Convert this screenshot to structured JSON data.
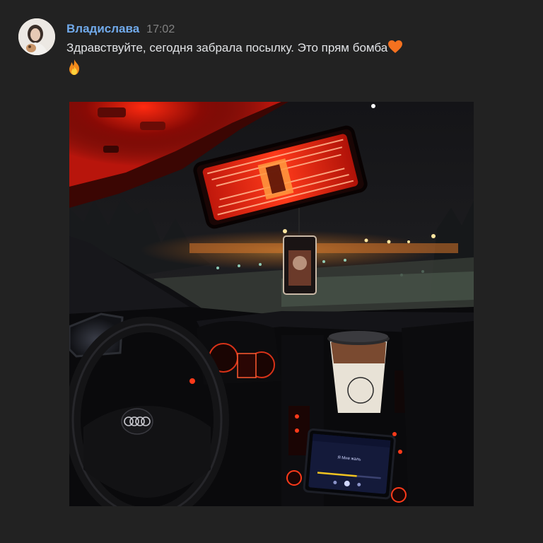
{
  "message": {
    "author": "Владислава",
    "time": "17:02",
    "text": "Здравствуйте, сегодня забрала посылку. Это прям бомба",
    "emoji_after_text": "orange-heart-icon",
    "emoji_second_line": "fire-icon"
  },
  "photo": {
    "screen_song_title": "Я Мне жаль",
    "subject": "car-interior-night-photo"
  },
  "colors": {
    "background": "#222222",
    "author_name": "#71aaeb",
    "timestamp": "#828282",
    "message_text": "#e1e3e6"
  }
}
